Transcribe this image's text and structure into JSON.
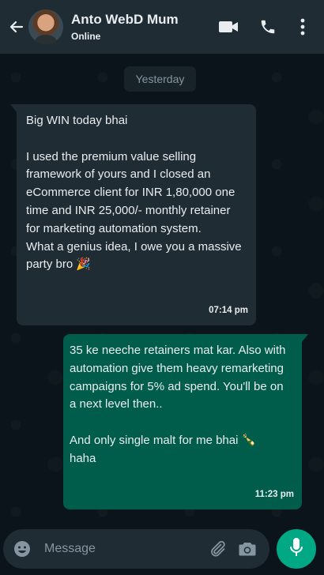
{
  "header": {
    "back_icon": "arrow-left-icon",
    "contact_name": "Anto WebD Mum",
    "status": "Online",
    "icons": [
      "video-call-icon",
      "voice-call-icon",
      "more-vertical-icon"
    ]
  },
  "chat": {
    "date_label": "Yesterday",
    "messages": [
      {
        "direction": "incoming",
        "text": "Big WIN today bhai\n\nI used the premium value selling framework of yours and I closed an eCommerce client for INR 1,80,000 one time and INR 25,000/- monthly retainer for marketing automation system.\nWhat a genius idea, I owe you a massive party bro 🎉",
        "time": "07:14 pm"
      },
      {
        "direction": "outgoing",
        "text": "35 ke neeche retainers mat kar. Also with automation give them heavy remarketing campaigns for 5% ad spend. You'll be on a next level then..\n\nAnd only single malt for me bhai 🍾\nhaha",
        "time": "11:23 pm"
      }
    ]
  },
  "composer": {
    "placeholder": "Message",
    "icons": [
      "emoji-icon",
      "attach-icon",
      "camera-icon",
      "mic-icon"
    ]
  },
  "colors": {
    "header_bg": "#1f2c34",
    "chat_bg": "#0b141a",
    "incoming_bubble": "#202c33",
    "outgoing_bubble": "#005c4b",
    "accent": "#00a884"
  }
}
